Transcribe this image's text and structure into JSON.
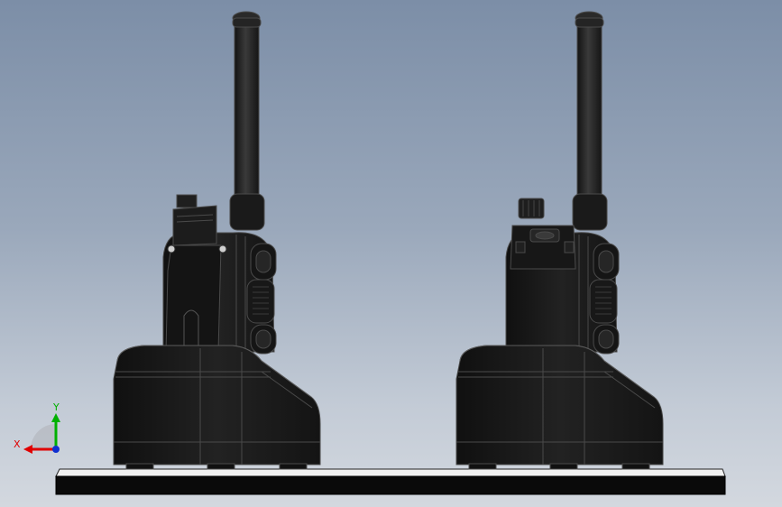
{
  "view": {
    "background_top": "#7c8ea7",
    "background_bottom": "#d3d8df"
  },
  "triad": {
    "x_label": "X",
    "y_label": "Y",
    "x_color": "#e00000",
    "y_color": "#00b000",
    "z_color": "#1030d0"
  },
  "model": {
    "radio_color": "#1b1b1b",
    "edge_color": "#4a4a4a",
    "highlight_color": "#5b5b5b",
    "base_plate_color": "#0a0a0a",
    "base_plate_top": "#f2f2f2"
  }
}
